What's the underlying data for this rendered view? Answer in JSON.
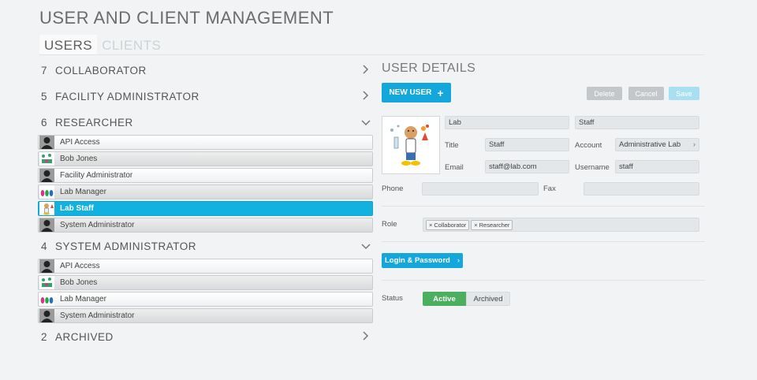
{
  "page": {
    "title": "USER AND CLIENT MANAGEMENT"
  },
  "tabs": [
    {
      "label": "USERS",
      "active": true
    },
    {
      "label": "CLIENTS",
      "active": false
    }
  ],
  "groups": [
    {
      "count": "7",
      "name": "COLLABORATOR",
      "expanded": false,
      "users": []
    },
    {
      "count": "5",
      "name": "FACILITY ADMINISTRATOR",
      "expanded": false,
      "users": []
    },
    {
      "count": "6",
      "name": "RESEARCHER",
      "expanded": true,
      "users": [
        {
          "name": "API Access",
          "avatar": "silhouette"
        },
        {
          "name": "Bob Jones",
          "avatar": "bob"
        },
        {
          "name": "Facility Administrator",
          "avatar": "silhouette"
        },
        {
          "name": "Lab Manager",
          "avatar": "drops"
        },
        {
          "name": "Lab Staff",
          "avatar": "scientist",
          "selected": true
        },
        {
          "name": "System Administrator",
          "avatar": "silhouette"
        }
      ]
    },
    {
      "count": "4",
      "name": "SYSTEM ADMINISTRATOR",
      "expanded": true,
      "users": [
        {
          "name": "API Access",
          "avatar": "silhouette"
        },
        {
          "name": "Bob Jones",
          "avatar": "bob"
        },
        {
          "name": "Lab Manager",
          "avatar": "drops"
        },
        {
          "name": "System Administrator",
          "avatar": "silhouette"
        }
      ]
    },
    {
      "count": "2",
      "name": "ARCHIVED",
      "expanded": false,
      "users": []
    }
  ],
  "icons": {
    "collapsed": "chevron-right-icon",
    "expanded": "chevron-down-icon"
  },
  "details": {
    "title": "USER DETAILS",
    "new_user_label": "NEW USER",
    "delete_label": "Delete",
    "cancel_label": "Cancel",
    "save_label": "Save",
    "first_name": "Lab",
    "last_name": "Staff",
    "title_label": "Title",
    "title_value": "Staff",
    "account_label": "Account",
    "account_value": "Administrative Lab",
    "email_label": "Email",
    "email_value": "staff@lab.com",
    "username_label": "Username",
    "username_value": "staff",
    "phone_label": "Phone",
    "phone_value": "",
    "fax_label": "Fax",
    "fax_value": "",
    "role_label": "Role",
    "roles": [
      "Collaborator",
      "Researcher"
    ],
    "login_label": "Login & Password",
    "status_label": "Status",
    "status_active": "Active",
    "status_archived": "Archived"
  },
  "colors": {
    "accent": "#14a7dc",
    "selected": "#12b1e0",
    "active_status": "#4cae5f"
  }
}
